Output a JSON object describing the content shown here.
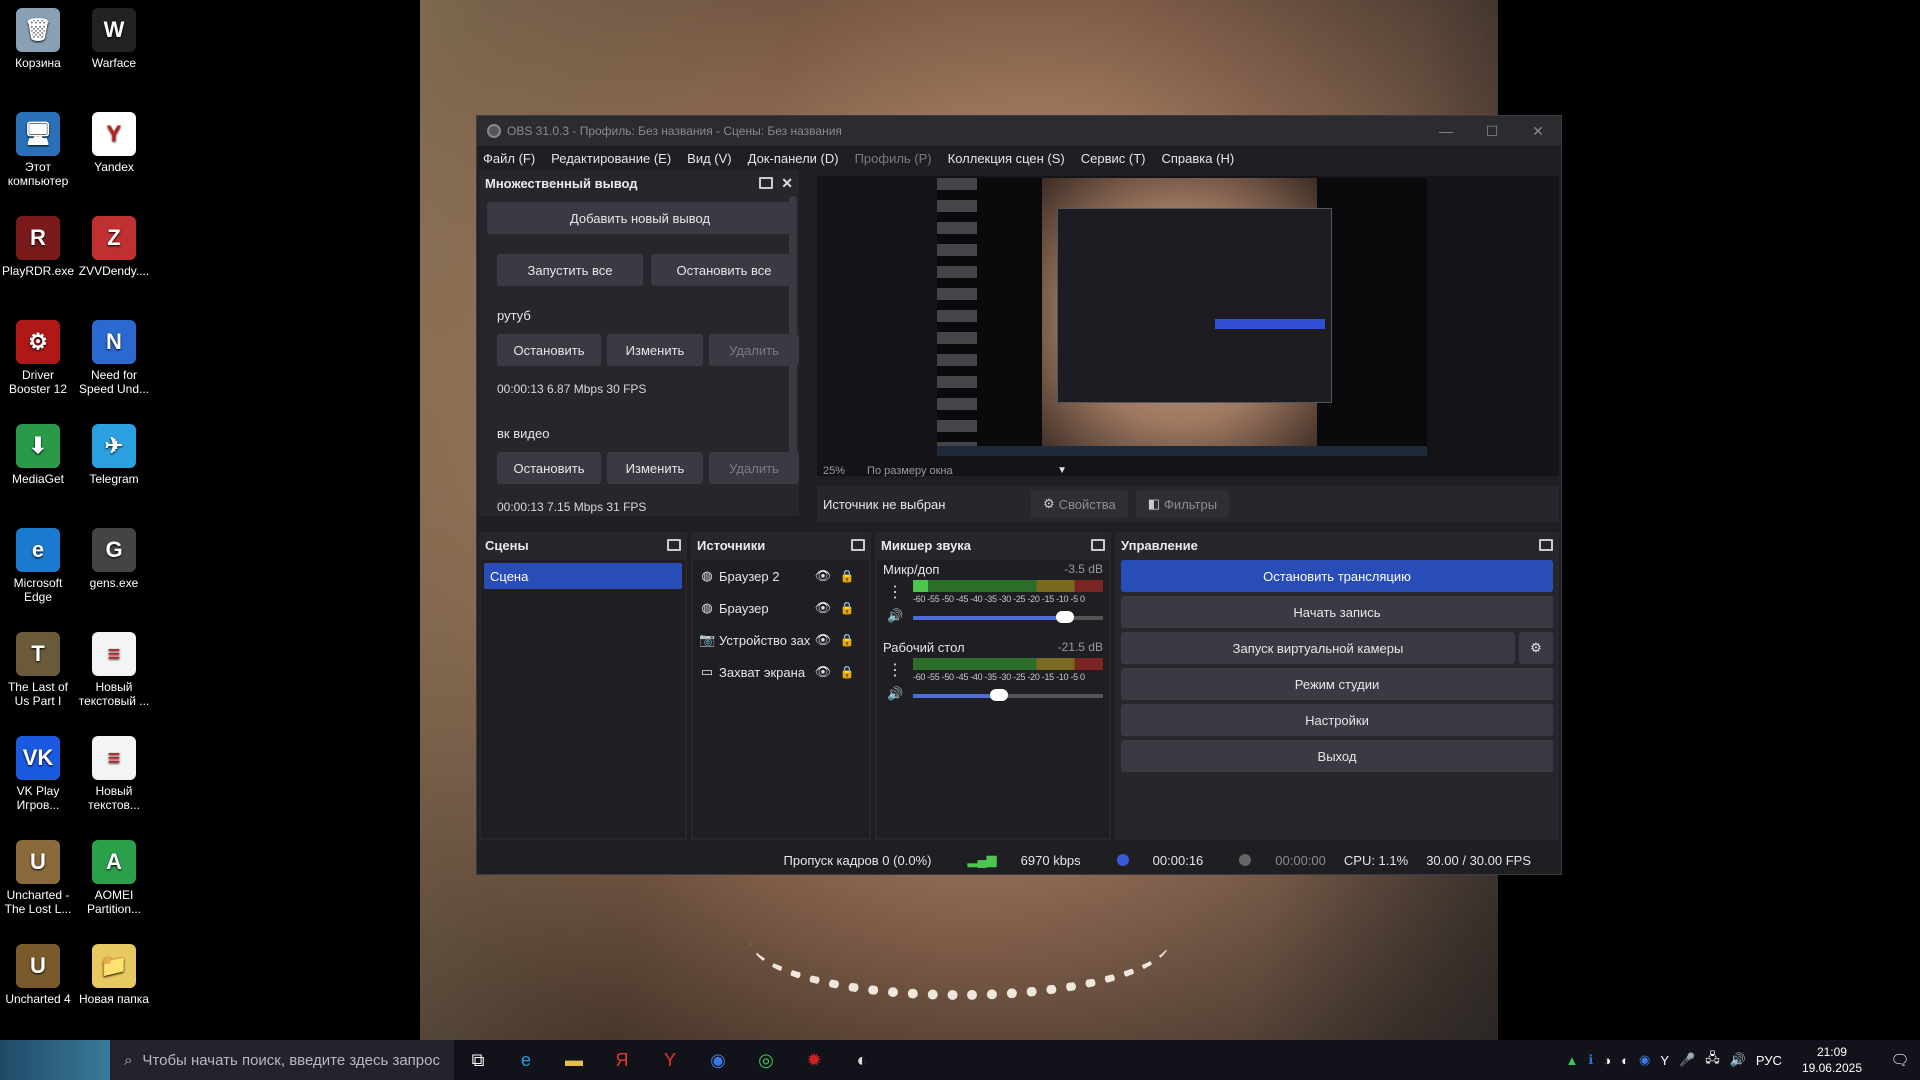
{
  "desktop": {
    "icons": [
      {
        "label": "Корзина",
        "glyph": "🗑",
        "color": "#8aa0b4"
      },
      {
        "label": "Warface",
        "glyph": "W",
        "color": "#222"
      },
      {
        "label": "Этот компьютер",
        "glyph": "🖥",
        "color": "#2a70b8"
      },
      {
        "label": "Yandex",
        "glyph": "Y",
        "color": "#ffffff"
      },
      {
        "label": "PlayRDR.exe",
        "glyph": "R",
        "color": "#7a1a1a"
      },
      {
        "label": "ZVVDendy....",
        "glyph": "Z",
        "color": "#c03030"
      },
      {
        "label": "Driver Booster 12",
        "glyph": "⚙",
        "color": "#b01818"
      },
      {
        "label": "Need for Speed Und...",
        "glyph": "N",
        "color": "#2a6ad0"
      },
      {
        "label": "MediaGet",
        "glyph": "⬇",
        "color": "#2a9a4a"
      },
      {
        "label": "Telegram",
        "glyph": "✈",
        "color": "#2aa0e0"
      },
      {
        "label": "Microsoft Edge",
        "glyph": "e",
        "color": "#1a7ad0"
      },
      {
        "label": "gens.exe",
        "glyph": "G",
        "color": "#444"
      },
      {
        "label": "The Last of Us Part I",
        "glyph": "T",
        "color": "#6a5a3a"
      },
      {
        "label": "Новый текстовый ...",
        "glyph": "≡",
        "color": "#f4f4f4"
      },
      {
        "label": "VK Play Игров...",
        "glyph": "VK",
        "color": "#1a5ae0"
      },
      {
        "label": "Новый текстов...",
        "glyph": "≡",
        "color": "#f4f4f4"
      },
      {
        "label": "Uncharted - The Lost L...",
        "glyph": "U",
        "color": "#8a6a3a"
      },
      {
        "label": "AOMEI Partition...",
        "glyph": "A",
        "color": "#2aa04a"
      },
      {
        "label": "Uncharted 4",
        "glyph": "U",
        "color": "#7a5a2a"
      },
      {
        "label": "Новая папка",
        "glyph": "📁",
        "color": "#e8c860"
      }
    ]
  },
  "obs": {
    "title": "OBS 31.0.3 - Профиль: Без названия - Сцены: Без названия",
    "menu": [
      "Файл (F)",
      "Редактирование (E)",
      "Вид (V)",
      "Док-панели (D)",
      "Профиль (P)",
      "Коллекция сцен (S)",
      "Сервис (T)",
      "Справка (H)"
    ],
    "multi_output": {
      "title": "Множественный вывод",
      "add_label": "Добавить новый вывод",
      "start_all": "Запустить все",
      "stop_all": "Остановить все",
      "outputs": [
        {
          "name": "рутуб",
          "stop": "Остановить",
          "edit": "Изменить",
          "delete": "Удалить",
          "stats": "00:00:13  6.87 Mbps  30 FPS"
        },
        {
          "name": "вк видео",
          "stop": "Остановить",
          "edit": "Изменить",
          "delete": "Удалить",
          "stats": "00:00:13  7.15 Mbps  31 FPS"
        }
      ]
    },
    "preview": {
      "zoom": "25%",
      "scale_mode": "По размеру окна"
    },
    "source_bar": {
      "no_source": "Источник не выбран",
      "properties": "Свойства",
      "filters": "Фильтры"
    },
    "scenes": {
      "title": "Сцены",
      "items": [
        "Сцена"
      ]
    },
    "sources": {
      "title": "Источники",
      "items": [
        {
          "label": "Браузер 2",
          "icon": "globe-icon"
        },
        {
          "label": "Браузер",
          "icon": "globe-icon"
        },
        {
          "label": "Устройство захвата",
          "icon": "camera-icon"
        },
        {
          "label": "Захват экрана",
          "icon": "monitor-icon"
        }
      ]
    },
    "mixer": {
      "title": "Микшер звука",
      "ticks": "-60 -55 -50 -45 -40 -35 -30 -25 -20 -15 -10 -5 0",
      "channels": [
        {
          "name": "Микр/доп",
          "db": "-3.5 dB",
          "level": 0.08,
          "volume": 0.8
        },
        {
          "name": "Рабочий стол",
          "db": "-21.5 dB",
          "level": 0.0,
          "volume": 0.45
        }
      ]
    },
    "controls": {
      "title": "Управление",
      "stop_stream": "Остановить трансляцию",
      "start_record": "Начать запись",
      "virtual_cam": "Запуск виртуальной камеры",
      "studio_mode": "Режим студии",
      "settings": "Настройки",
      "exit": "Выход"
    },
    "status": {
      "dropped": "Пропуск кадров 0 (0.0%)",
      "bitrate": "6970 kbps",
      "stream_time": "00:00:16",
      "record_time": "00:00:00",
      "cpu": "CPU: 1.1%",
      "fps": "30.00 / 30.00 FPS"
    }
  },
  "taskbar": {
    "search_placeholder": "Чтобы начать поиск, введите здесь запрос",
    "lang": "РУС",
    "time": "21:09",
    "date": "19.06.2025"
  }
}
